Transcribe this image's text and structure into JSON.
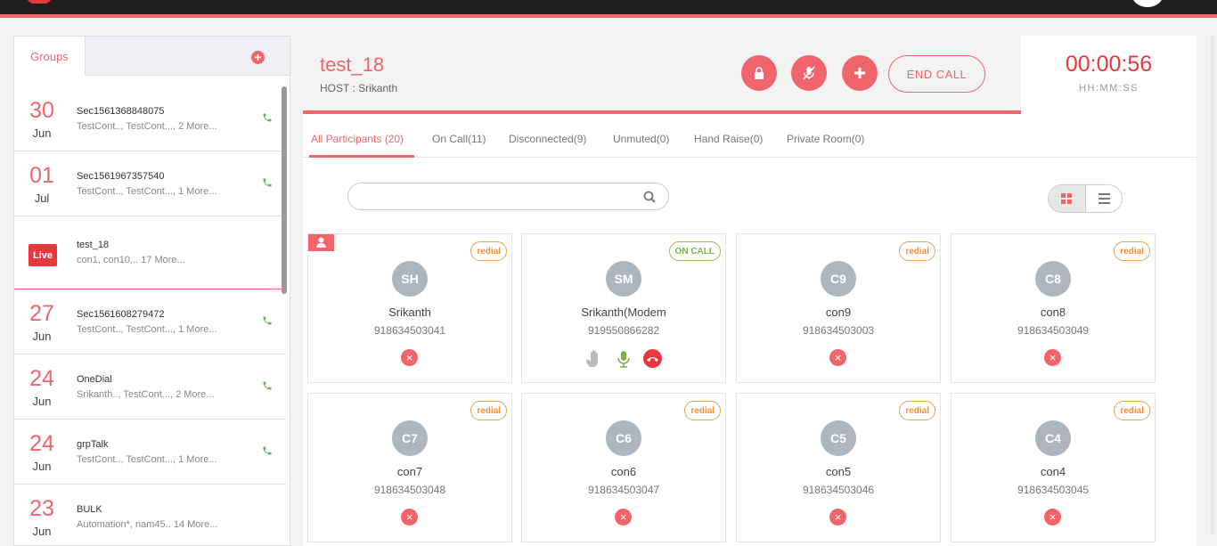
{
  "sidebar": {
    "tab_label": "Groups",
    "add_icon": "plus-circle-icon",
    "groups": [
      {
        "day": "30",
        "month": "Jun",
        "name": "Sec1561368848075",
        "members": "TestCont.., TestCont..., 2 More..."
      },
      {
        "day": "01",
        "month": "Jul",
        "name": "Sec1561967357540",
        "members": "TestCont.., TestCont..., 1 More..."
      },
      {
        "live": "Live",
        "name": "test_18",
        "members": "con1, con10,.. 17 More..."
      },
      {
        "day": "27",
        "month": "Jun",
        "name": "Sec1561608279472",
        "members": "TestCont.., TestCont..., 1 More..."
      },
      {
        "day": "24",
        "month": "Jun",
        "name": "OneDial",
        "members": "Srikanth.., TestCont..., 2 More..."
      },
      {
        "day": "24",
        "month": "Jun",
        "name": "grpTalk",
        "members": "TestCont.., TestCont..., 1 More..."
      },
      {
        "day": "23",
        "month": "Jun",
        "name": "BULK",
        "members": "Automation*, nam45.. 14 More..."
      }
    ]
  },
  "call": {
    "title": "test_18",
    "host": "HOST : Srikanth",
    "end_call": "END CALL",
    "timer": "00:00:56",
    "timer_format": "HH:MM:SS"
  },
  "tabs": [
    {
      "label": "All Participants (20)"
    },
    {
      "label": "On Call(11)"
    },
    {
      "label": "Disconnected(9)"
    },
    {
      "label": "Unmuted(0)"
    },
    {
      "label": "Hand Raise(0)"
    },
    {
      "label": "Private Room(0)"
    }
  ],
  "search": {
    "placeholder": ""
  },
  "participants": [
    {
      "initials": "SH",
      "name": "Srikanth",
      "number": "918634503041",
      "status": "redial"
    },
    {
      "initials": "SM",
      "name": "Srikanth(Modem",
      "number": "919550866282",
      "status": "ON CALL"
    },
    {
      "initials": "C9",
      "name": "con9",
      "number": "918634503003",
      "status": "redial"
    },
    {
      "initials": "C8",
      "name": "con8",
      "number": "918634503049",
      "status": "redial"
    },
    {
      "initials": "C7",
      "name": "con7",
      "number": "918634503048",
      "status": "redial"
    },
    {
      "initials": "C6",
      "name": "con6",
      "number": "918634503047",
      "status": "redial"
    },
    {
      "initials": "C5",
      "name": "con5",
      "number": "918634503046",
      "status": "redial"
    },
    {
      "initials": "C4",
      "name": "con4",
      "number": "918634503045",
      "status": "redial"
    }
  ],
  "colors": {
    "accent": "#f2646b",
    "live": "#e8383d",
    "oncall": "#7cb342",
    "redial": "#f0903c"
  }
}
